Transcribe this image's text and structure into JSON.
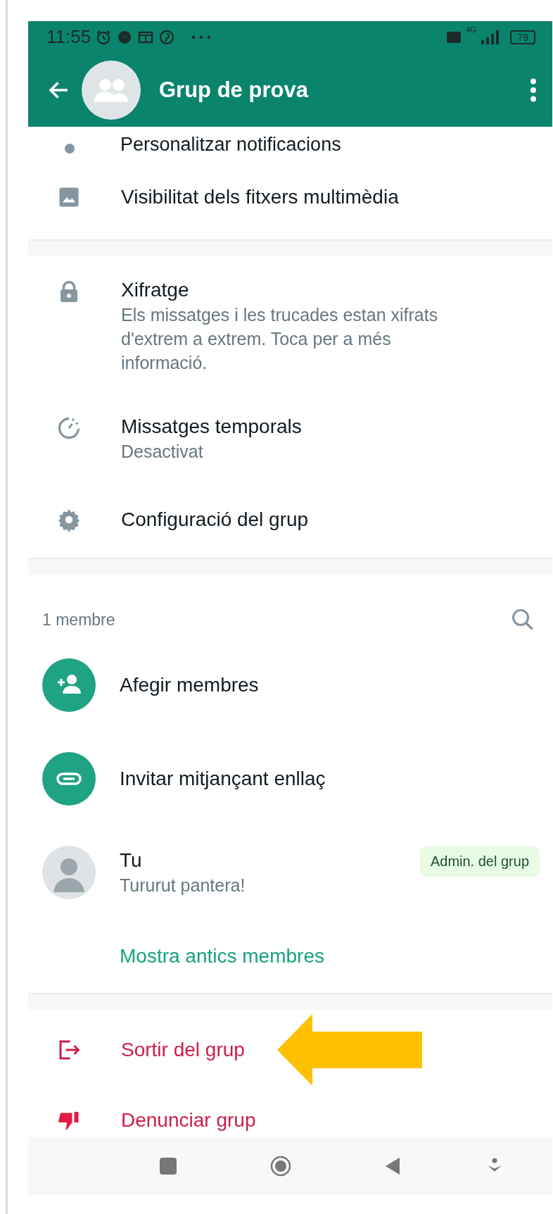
{
  "status_bar": {
    "time": "11:55",
    "network": "4G",
    "battery": "79"
  },
  "header": {
    "title": "Grup de prova"
  },
  "partial_item": {
    "title": "Personalitzar notificacions"
  },
  "media_item": {
    "kind": "image",
    "title": "Visibilitat dels fitxers multimèdia"
  },
  "settings": [
    {
      "kind": "lock",
      "title": "Xifratge",
      "subtitle": "Els missatges i les trucades estan xifrats d'extrem a extrem. Toca per a més informació."
    },
    {
      "kind": "timer",
      "title": "Missatges temporals",
      "subtitle": "Desactivat"
    },
    {
      "kind": "gear",
      "title": "Configuració del grup"
    }
  ],
  "members": {
    "count_label": "1 membre",
    "actions": [
      {
        "kind": "add-person",
        "title": "Afegir membres"
      },
      {
        "kind": "link",
        "title": "Invitar mitjançant enllaç"
      }
    ],
    "list": [
      {
        "name": "Tu",
        "status": "Tururut pantera!",
        "badge": "Admin. del grup"
      }
    ],
    "show_past": "Mostra antics membres"
  },
  "danger_actions": [
    {
      "kind": "exit",
      "title": "Sortir del grup",
      "highlighted": true
    },
    {
      "kind": "thumbs-down",
      "title": "Denunciar grup",
      "highlighted": false
    }
  ]
}
